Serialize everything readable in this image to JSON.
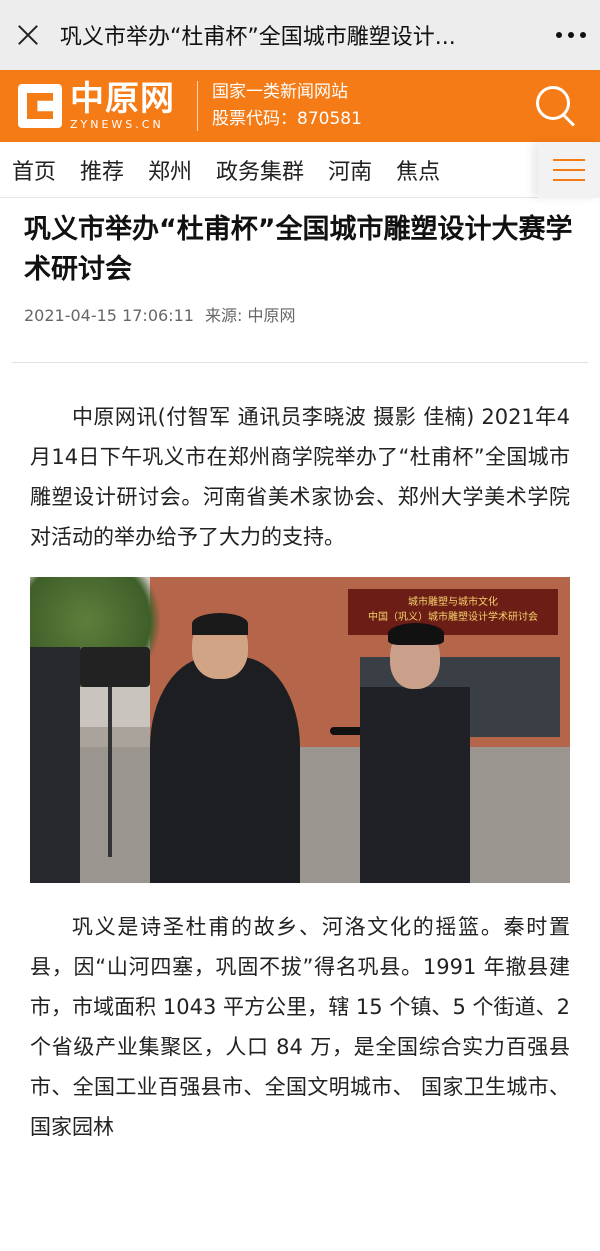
{
  "topbar": {
    "title": "巩义市举办“杜甫杯”全国城市雕塑设计..."
  },
  "brand": {
    "logo_name": "中原网",
    "logo_domain": "ZYNEWS.CN",
    "info_line1": "国家一类新闻网站",
    "info_line2": "股票代码：870581",
    "accent": "#f47b16"
  },
  "nav": {
    "items": [
      "首页",
      "推荐",
      "郑州",
      "政务集群",
      "河南",
      "焦点"
    ]
  },
  "article": {
    "headline": "巩义市举办“杜甫杯”全国城市雕塑设计大赛学术研讨会",
    "datetime": "2021-04-15 17:06:11",
    "source": "来源: 中原网",
    "para1": "中原网讯(付智军 通讯员李晓波 摄影 佳楠) 2021年4月14日下午巩义市在郑州商学院举办了“杜甫杯”全国城市雕塑设计研讨会。河南省美术家协会、郑州大学美术学院对活动的举办给予了大力的支持。",
    "photo_banner_line1": "城市雕塑与城市文化",
    "photo_banner_line2": "中国（巩义）城市雕塑设计学术研讨会",
    "para2": "巩义是诗圣杜甫的故乡、河洛文化的摇篮。秦时置县，因“山河四塞，巩固不拔”得名巩县。1991 年撤县建市，市域面积 1043 平方公里，辖 15 个镇、5 个街道、2 个省级产业集聚区，人口 84 万，是全国综合实力百强县市、全国工业百强县市、全国文明城市、 国家卫生城市、国家园林"
  }
}
